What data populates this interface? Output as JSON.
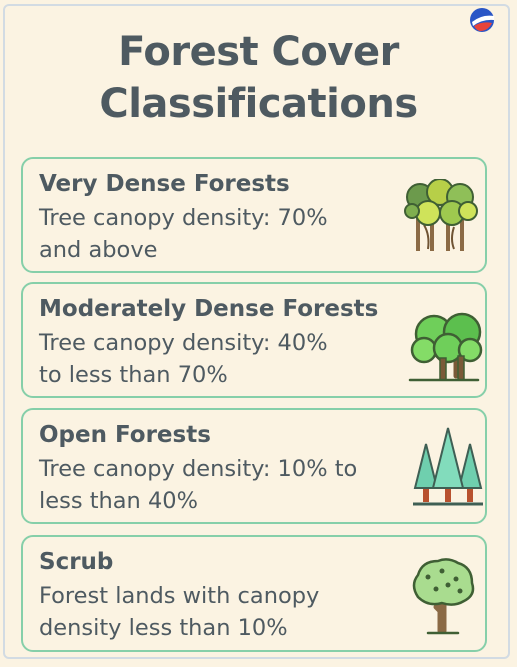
{
  "title": {
    "line1": "Forest Cover",
    "line2": "Classifications"
  },
  "categories": [
    {
      "name": "Very Dense Forests",
      "description_lines": [
        "Tree canopy density: 70%",
        "and above"
      ],
      "icon": "rainforest-trees-icon"
    },
    {
      "name": "Moderately Dense Forests",
      "description_lines": [
        "Tree canopy density: 40%",
        "to less than 70%"
      ],
      "icon": "broadleaf-trees-icon"
    },
    {
      "name": "Open Forests",
      "description_lines": [
        "Tree canopy density: 10% to",
        "less than 40%"
      ],
      "icon": "pine-trees-icon"
    },
    {
      "name": "Scrub",
      "description_lines": [
        "Forest lands with canopy",
        "density less than 10%"
      ],
      "icon": "single-tree-icon"
    }
  ],
  "colors": {
    "background": "#fbf3e2",
    "card_border": "#86cfa9",
    "text": "#4e5a61"
  }
}
